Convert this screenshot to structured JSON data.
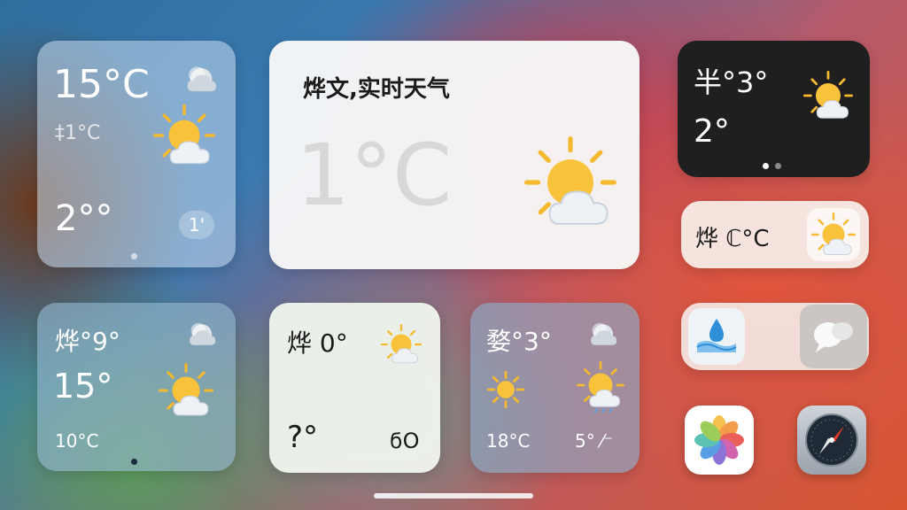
{
  "widgets": {
    "w1": {
      "temp": "15°C",
      "sub": "‡1°C",
      "low": "2°°",
      "badge": "1'"
    },
    "w2": {
      "title": "烨文,实时天气",
      "temp": "1°C"
    },
    "w3": {
      "title": "半°3°",
      "temp": "2°"
    },
    "w4": {
      "label": "烨 ℂ°C"
    },
    "w5": {
      "title": "烨°9°",
      "temp": "15°",
      "low": "10°C"
    },
    "w6": {
      "title": "烨 0°",
      "temp": "?°",
      "badge": "ϭO"
    },
    "w7": {
      "title": "婺°3°",
      "low": "18°C",
      "side": "5° ⁄⁻"
    }
  },
  "colors": {
    "sun": "#f8c23a",
    "cloud": "#eef1f5",
    "accent_blue": "#2f8fd8"
  },
  "icons": [
    "sun-cloud-icon",
    "moon-cloud-icon",
    "rain-cloud-icon",
    "water-drop-icon",
    "chat-bubbles-icon",
    "photos-app-icon",
    "compass-app-icon"
  ]
}
